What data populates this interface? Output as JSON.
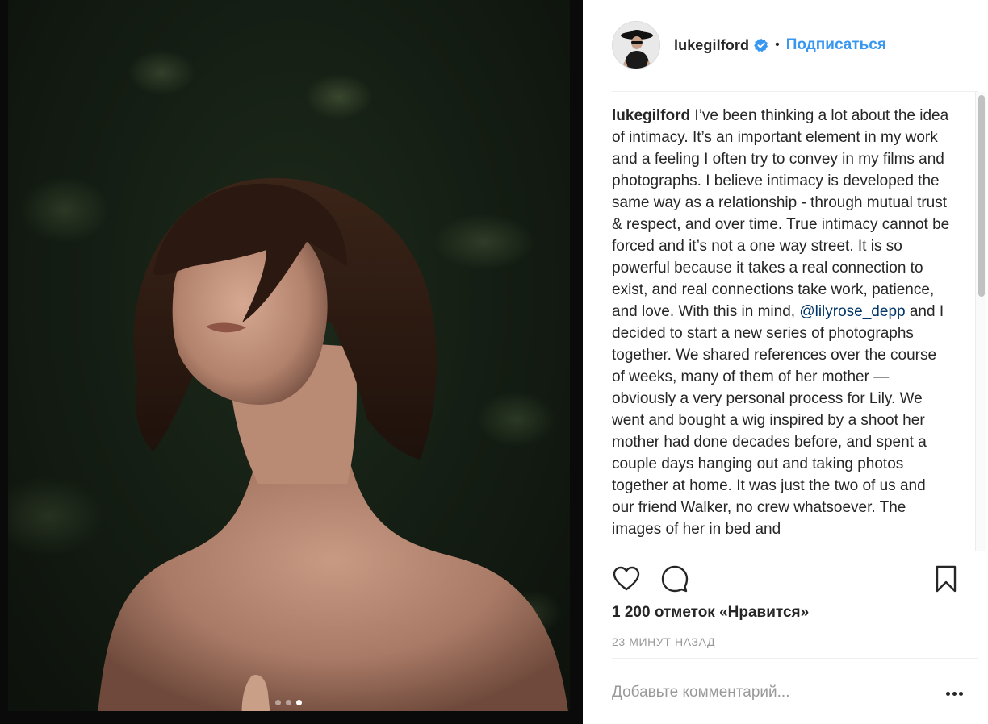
{
  "photo": {
    "alt": "",
    "carousel_count": 3,
    "carousel_active": 2
  },
  "post": {
    "username": "lukegilford",
    "verified": true,
    "bullet": "•",
    "follow_label": "Подписаться"
  },
  "caption": {
    "username": "lukegilford",
    "text_before_mention": " I’ve been thinking a lot about the idea of intimacy. It’s an important element in my work and a feeling I often try to convey in my films and photographs. I believe intimacy is developed the same way as a relationship - through mutual trust & respect, and over time. True intimacy cannot be forced and it’s not a one way street. It is so powerful because it takes a real connection to exist, and real connections take work, patience, and love. With this in mind, ",
    "mention": "@lilyrose_depp",
    "text_after_mention": " and I decided to start a new series of photographs together. We shared references over the course of weeks, many of them of her mother — obviously a very personal process for Lily. We went and bought a wig inspired by a shoot her mother had done decades before, and spent a couple days hanging out and taking photos together at home. It was just the two of us and our friend Walker, no crew whatsoever. The images of her in bed and"
  },
  "actions": {
    "like_icon": "heart-icon",
    "comment_icon": "comment-bubble-icon",
    "save_icon": "bookmark-icon"
  },
  "likes": "1 200 отметок «Нравится»",
  "timestamp": "23 минут назад",
  "comment": {
    "placeholder": "Добавьте комментарий...",
    "more_icon": "more-options-icon"
  },
  "colors": {
    "accent": "#3897f0",
    "mention": "#003569",
    "muted": "#999999",
    "text": "#262626"
  }
}
